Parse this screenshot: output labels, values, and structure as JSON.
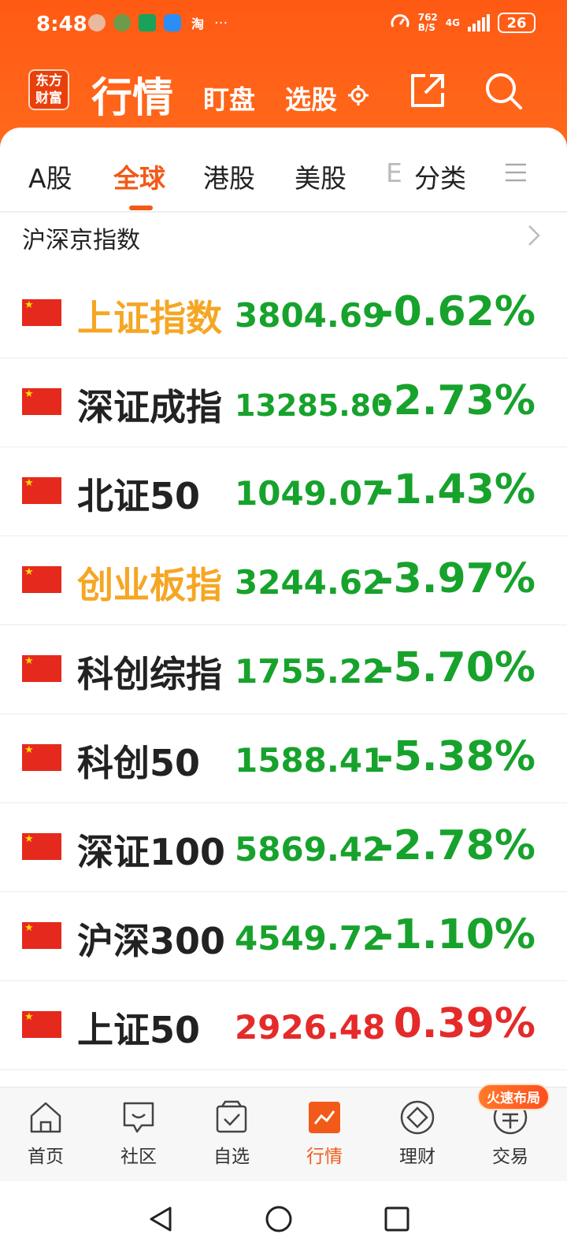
{
  "status": {
    "time": "8:48",
    "taobao": "淘",
    "more": "···",
    "net_rate_top": "762",
    "net_rate_bottom": "B/S",
    "network": "4G",
    "battery": "26"
  },
  "header": {
    "logo": "东方财富",
    "title": "行情",
    "dingpan": "盯盘",
    "xuangu": "选股"
  },
  "tabs": [
    {
      "label": "A股"
    },
    {
      "label": "全球"
    },
    {
      "label": "港股"
    },
    {
      "label": "美股"
    },
    {
      "label": "E"
    },
    {
      "label": "分类"
    }
  ],
  "section": {
    "title": "沪深京指数"
  },
  "indices": [
    {
      "name": "上证指数",
      "price": "3804.69",
      "change": "-0.62%",
      "trend": "down",
      "highlight": true
    },
    {
      "name": "深证成指",
      "price": "13285.80",
      "change": "-2.73%",
      "trend": "down",
      "highlight": false
    },
    {
      "name": "北证50",
      "price": "1049.07",
      "change": "-1.43%",
      "trend": "down",
      "highlight": false
    },
    {
      "name": "创业板指",
      "price": "3244.62",
      "change": "-3.97%",
      "trend": "down",
      "highlight": true
    },
    {
      "name": "科创综指",
      "price": "1755.22",
      "change": "-5.70%",
      "trend": "down",
      "highlight": false
    },
    {
      "name": "科创50",
      "price": "1588.41",
      "change": "-5.38%",
      "trend": "down",
      "highlight": false
    },
    {
      "name": "深证100",
      "price": "5869.42",
      "change": "-2.78%",
      "trend": "down",
      "highlight": false
    },
    {
      "name": "沪深300",
      "price": "4549.72",
      "change": "-1.10%",
      "trend": "down",
      "highlight": false
    },
    {
      "name": "上证50",
      "price": "2926.48",
      "change": "0.39%",
      "trend": "up",
      "highlight": false
    }
  ],
  "bottom_nav": [
    {
      "label": "首页",
      "icon": "home-icon"
    },
    {
      "label": "社区",
      "icon": "community-icon"
    },
    {
      "label": "自选",
      "icon": "watchlist-icon"
    },
    {
      "label": "行情",
      "icon": "market-icon"
    },
    {
      "label": "理财",
      "icon": "finance-icon"
    },
    {
      "label": "交易",
      "icon": "trade-icon"
    }
  ],
  "promo": "火速布局",
  "colors": {
    "brand": "#ff5a14",
    "active": "#f15a18",
    "up": "#e52a2a",
    "down": "#17a22c",
    "highlight": "#f5a623"
  }
}
